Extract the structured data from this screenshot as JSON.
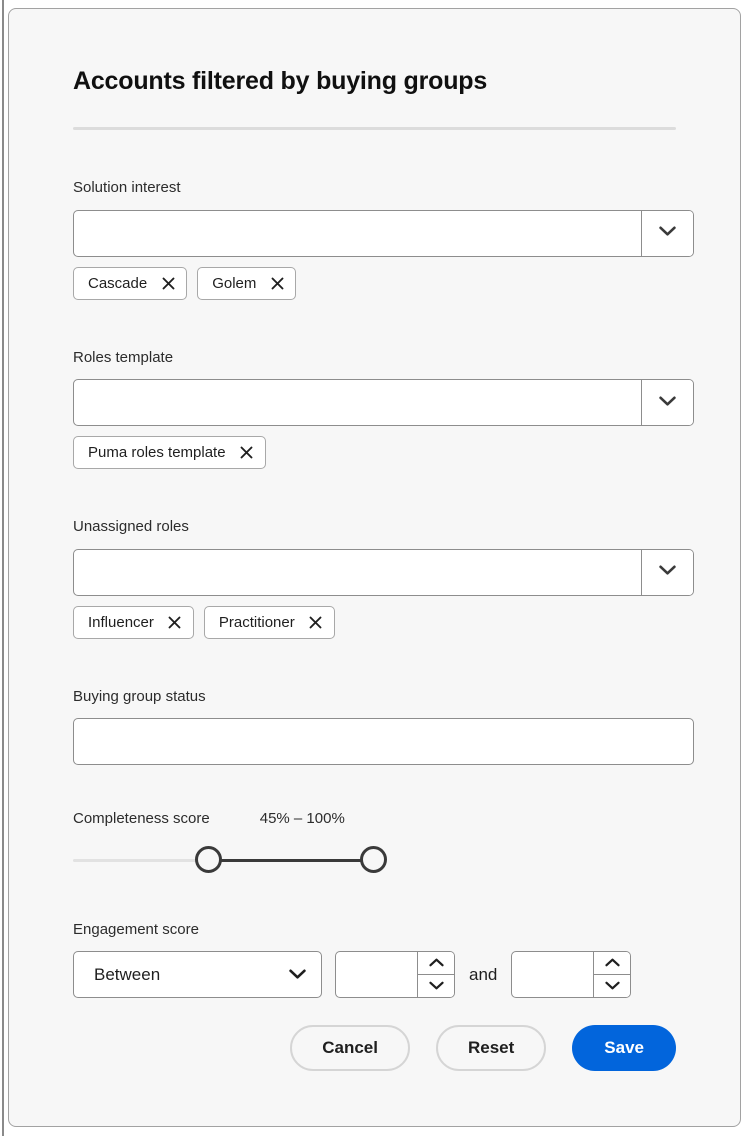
{
  "dialog": {
    "title": "Accounts filtered by buying groups"
  },
  "fields": {
    "solution_interest": {
      "label": "Solution interest",
      "value": "",
      "placeholder": "",
      "dropdown_icon": "chevron-down-icon",
      "chips": [
        {
          "label": "Cascade",
          "close_icon": "close-icon"
        },
        {
          "label": "Golem",
          "close_icon": "close-icon"
        }
      ]
    },
    "roles_template": {
      "label": "Roles template",
      "value": "",
      "placeholder": "",
      "dropdown_icon": "chevron-down-icon",
      "chips": [
        {
          "label": "Puma roles template",
          "close_icon": "close-icon"
        }
      ]
    },
    "unassigned_roles": {
      "label": "Unassigned roles",
      "value": "",
      "placeholder": "",
      "dropdown_icon": "chevron-down-icon",
      "chips": [
        {
          "label": "Influencer",
          "close_icon": "close-icon"
        },
        {
          "label": "Practitioner",
          "close_icon": "close-icon"
        }
      ]
    },
    "buying_group_status": {
      "label": "Buying group status",
      "value": "",
      "placeholder": ""
    },
    "completeness_score": {
      "label": "Completeness score",
      "range_text": "45% – 100%",
      "min_percent": 45,
      "max_percent": 100
    },
    "engagement_score": {
      "label": "Engagement score",
      "operator": "Between",
      "operator_icon": "chevron-down-icon",
      "conjunction": "and",
      "min_value": "",
      "max_value": "",
      "stepper_up_icon": "chevron-up-icon",
      "stepper_down_icon": "chevron-down-icon"
    }
  },
  "footer": {
    "cancel_label": "Cancel",
    "reset_label": "Reset",
    "save_label": "Save"
  },
  "colors": {
    "accent": "#0265dc",
    "background": "#f7f7f7",
    "border": "#8d8d8d",
    "text": "#1f1f1f"
  }
}
